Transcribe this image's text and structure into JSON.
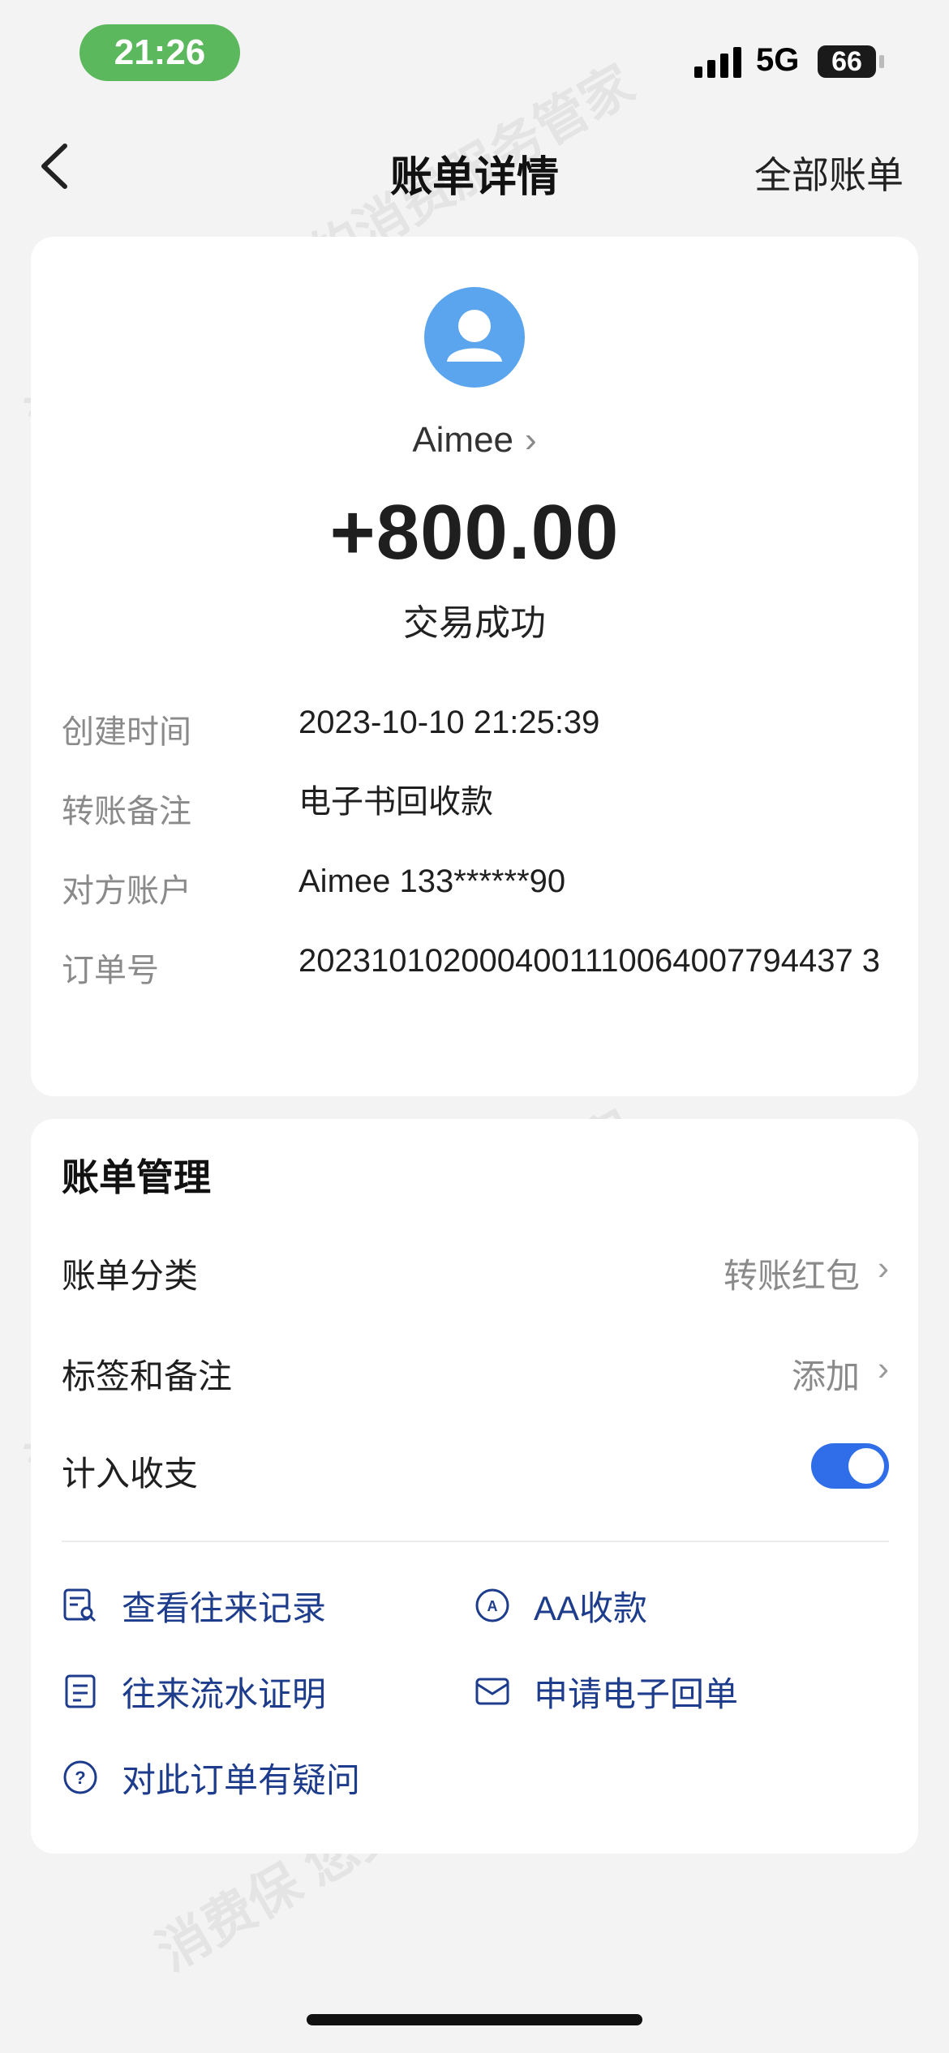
{
  "status_bar": {
    "time": "21:26",
    "network": "5G",
    "battery": "66"
  },
  "nav": {
    "title": "账单详情",
    "right_link": "全部账单",
    "back_icon": "chevron-left-icon"
  },
  "transaction": {
    "payee": "Aimee",
    "amount": "+800.00",
    "status": "交易成功",
    "details": [
      {
        "label": "创建时间",
        "value": "2023-10-10 21:25:39"
      },
      {
        "label": "转账备注",
        "value": "电子书回收款"
      },
      {
        "label": "对方账户",
        "value": "Aimee 133******90"
      },
      {
        "label": "订单号",
        "value": "2023101020004001110064007794437 3"
      }
    ]
  },
  "management": {
    "title": "账单管理",
    "rows": [
      {
        "label": "账单分类",
        "value": "转账红包"
      },
      {
        "label": "标签和备注",
        "value": "添加"
      },
      {
        "label": "计入收支",
        "toggle_on": true
      }
    ],
    "actions": [
      {
        "label": "查看往来记录",
        "icon": "record-search-icon"
      },
      {
        "label": "AA收款",
        "icon": "aa-collect-icon"
      },
      {
        "label": "往来流水证明",
        "icon": "statement-proof-icon"
      },
      {
        "label": "申请电子回单",
        "icon": "envelope-icon"
      },
      {
        "label": "对此订单有疑问",
        "icon": "question-circle-icon"
      }
    ]
  },
  "watermark": "消费保 您身边的消费服务管家",
  "colors": {
    "accent": "#2f6ee8",
    "action_text": "#1e3c8c",
    "avatar": "#5ba5ee",
    "time_pill": "#5cb85c"
  }
}
